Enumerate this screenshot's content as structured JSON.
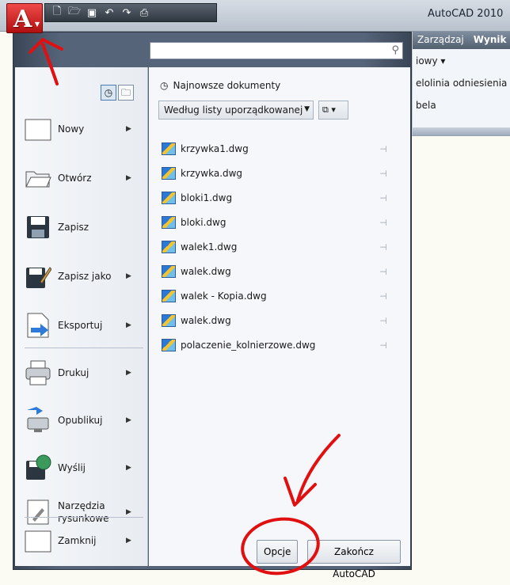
{
  "window": {
    "title": "AutoCAD 2010"
  },
  "app_button": {
    "letter": "A"
  },
  "qat_icons": [
    "new-icon",
    "open-icon",
    "save-icon",
    "undo-icon",
    "redo-icon",
    "print-icon"
  ],
  "ribbon": {
    "tabs": [
      "Zarządzaj",
      "Wynik"
    ],
    "rows": [
      "iowy ▾",
      "elolinia odniesienia",
      "bela"
    ]
  },
  "menu": {
    "left_items": [
      {
        "label": "Nowy",
        "icon": "new-document-icon",
        "arrow": "▶"
      },
      {
        "label": "Otwórz",
        "icon": "open-folder-icon",
        "arrow": "▶"
      },
      {
        "label": "Zapisz",
        "icon": "save-icon",
        "arrow": ""
      },
      {
        "label": "Zapisz jako",
        "icon": "save-as-icon",
        "arrow": "▶"
      },
      {
        "label": "Eksportuj",
        "icon": "export-icon",
        "arrow": "▶"
      },
      {
        "label": "Drukuj",
        "icon": "print-icon",
        "arrow": "▶"
      },
      {
        "label": "Opublikuj",
        "icon": "publish-icon",
        "arrow": "▶"
      },
      {
        "label": "Wyślij",
        "icon": "send-icon",
        "arrow": "▶"
      },
      {
        "label": "Narzędzia rysunkowe",
        "icon": "drawing-tools-icon",
        "arrow": "▶"
      },
      {
        "label": "Zamknij",
        "icon": "close-icon",
        "arrow": "▶"
      }
    ]
  },
  "search": {
    "placeholder": "",
    "value": ""
  },
  "recent": {
    "title": "Najnowsze dokumenty",
    "sort_dropdown": "Według listy uporządkowanej",
    "files": [
      "krzywka1.dwg",
      "krzywka.dwg",
      "bloki1.dwg",
      "bloki.dwg",
      "walek1.dwg",
      "walek.dwg",
      "walek - Kopia.dwg",
      "walek.dwg",
      "polaczenie_kolnierzowe.dwg"
    ]
  },
  "buttons": {
    "options": "Opcje",
    "exit": "Zakończ AutoCAD"
  },
  "colors": {
    "app_red": "#d42020",
    "annotation_red": "#e01010",
    "menu_frame": "#56647a"
  }
}
